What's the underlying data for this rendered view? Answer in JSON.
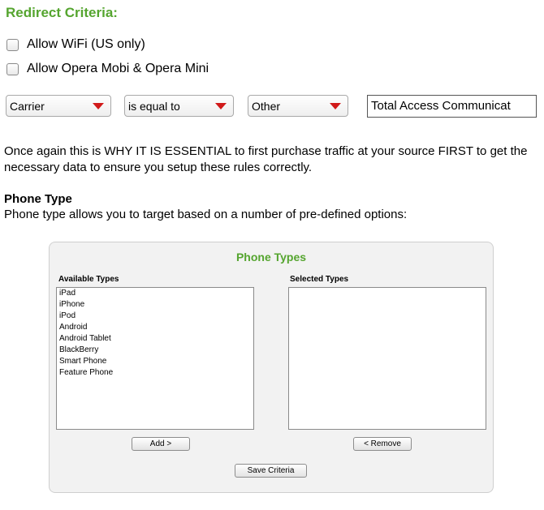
{
  "criteria": {
    "title": "Redirect Criteria:",
    "options": [
      {
        "label": "Allow WiFi (US only)",
        "checked": false
      },
      {
        "label": "Allow Opera Mobi & Opera Mini",
        "checked": false
      }
    ],
    "rule": {
      "field": "Carrier",
      "operator": "is equal to",
      "value_type": "Other",
      "value": "Total Access Communicat"
    }
  },
  "content": {
    "paragraph": "Once again this is WHY IT IS ESSENTIAL to first purchase traffic at your source FIRST to get the necessary data to ensure you setup these rules correctly.",
    "heading": "Phone Type",
    "description": "Phone type allows you to target based on a number of pre-defined options:"
  },
  "phone_types": {
    "title": "Phone Types",
    "available_label": "Available Types",
    "selected_label": "Selected Types",
    "available": [
      "iPad",
      "iPhone",
      "iPod",
      "Android",
      "Android Tablet",
      "BlackBerry",
      "Smart Phone",
      "Feature Phone"
    ],
    "selected": [],
    "add_label": "Add >",
    "remove_label": "< Remove",
    "save_label": "Save Criteria"
  },
  "colors": {
    "accent_green": "#55a52f",
    "dropdown_arrow": "#d11a1a"
  }
}
